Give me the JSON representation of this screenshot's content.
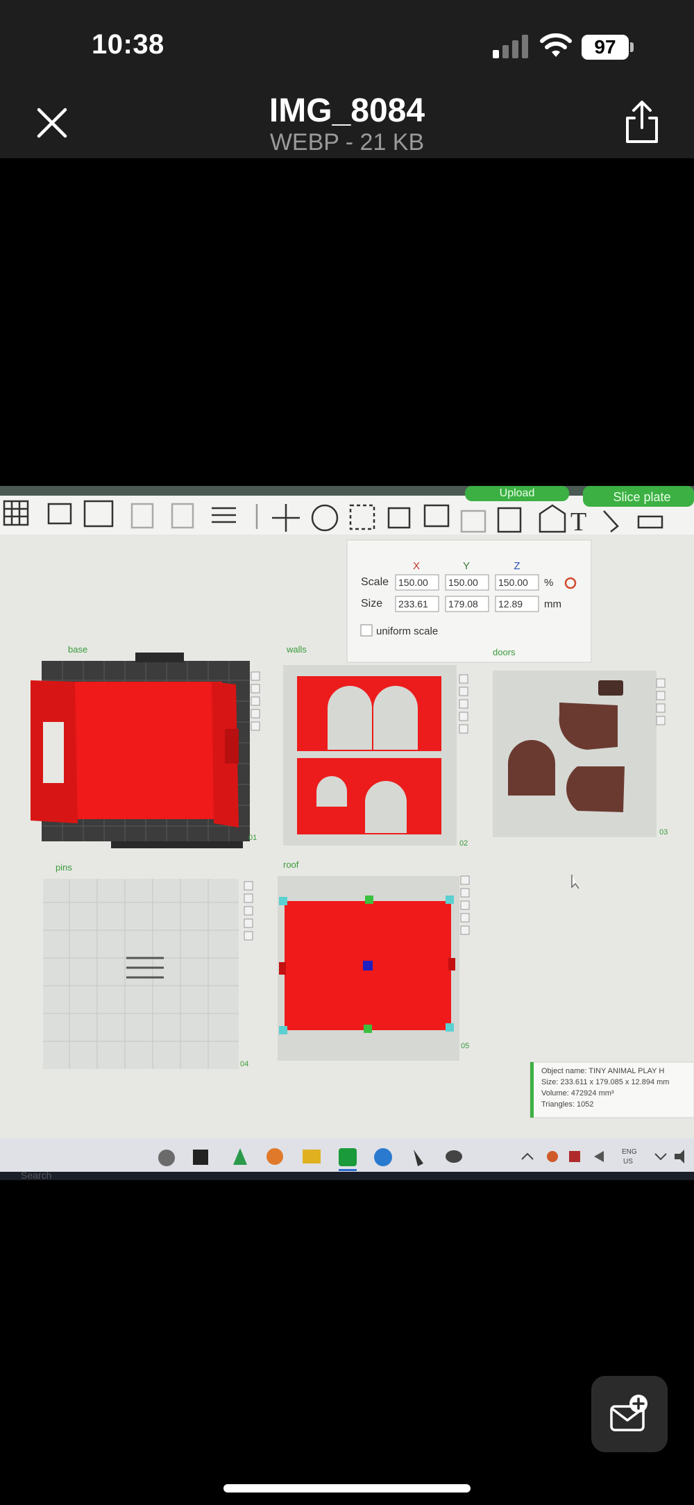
{
  "status_bar": {
    "time": "10:38",
    "battery": "97"
  },
  "header": {
    "title": "IMG_8084",
    "subtitle": "WEBP - 21 KB"
  },
  "photo": {
    "top_buttons": {
      "upload": "Upload",
      "slice_plate": "Slice plate"
    },
    "scale_panel": {
      "axes": [
        "X",
        "Y",
        "Z"
      ],
      "scale_label": "Scale",
      "scale_values": [
        "150.00",
        "150.00",
        "150.00"
      ],
      "scale_unit": "%",
      "size_label": "Size",
      "size_values": [
        "233.61",
        "179.08",
        "12.89"
      ],
      "size_unit": "mm",
      "uniform_label": "uniform scale"
    },
    "plates": [
      {
        "name": "base",
        "number": "01"
      },
      {
        "name": "walls",
        "number": "02"
      },
      {
        "name": "doors",
        "number": "03"
      },
      {
        "name": "pins",
        "number": "04"
      },
      {
        "name": "roof",
        "number": "05"
      }
    ],
    "object_info": {
      "name": "Object name: TINY ANIMAL PLAY H",
      "size": "Size: 233.611 x 179.085 x 12.894 mm",
      "volume": "Volume: 472924 mm³",
      "triangles": "Triangles: 1052"
    },
    "taskbar": {
      "search": "Search",
      "lang_top": "ENG",
      "lang_bottom": "US"
    }
  },
  "colors": {
    "model_red": "#f01a1a",
    "door_brown": "#6a3a30",
    "accent_green": "#3cb043",
    "panel_bg": "#1e1e1e"
  }
}
